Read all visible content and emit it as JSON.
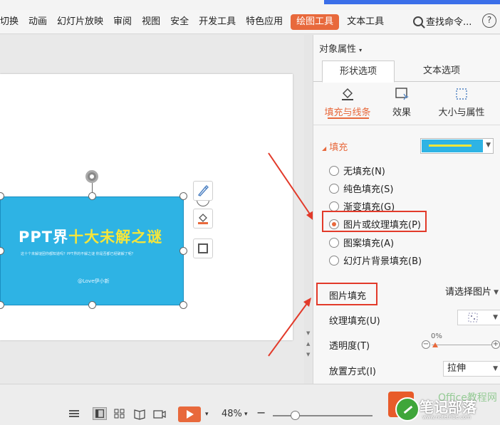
{
  "menu": {
    "items": [
      "切换",
      "动画",
      "幻灯片放映",
      "审阅",
      "视图",
      "安全",
      "开发工具",
      "特色应用",
      "绘图工具",
      "文本工具"
    ],
    "active_index": 8,
    "search_label": "查找命令...",
    "help_label": "?"
  },
  "slide": {
    "title_main": "PPT界",
    "title_highlight": "十大未解之谜",
    "subtitle": "这十个未解谜团你都知道吗？PPT界的不解之谜 你是否都已经破解了呢？",
    "author": "@Love伊小新"
  },
  "panel": {
    "title": "对象属性",
    "tabs": [
      "形状选项",
      "文本选项"
    ],
    "subtabs": [
      "填充与线条",
      "效果",
      "大小与属性"
    ],
    "fill_section": "填充",
    "fill_options": [
      "无填充(N)",
      "纯色填充(S)",
      "渐变填充(G)",
      "图片或纹理填充(P)",
      "图案填充(A)",
      "幻灯片背景填充(B)"
    ],
    "fill_selected_index": 3,
    "picture_fill_label": "图片填充",
    "picture_fill_value": "请选择图片",
    "texture_label": "纹理填充(U)",
    "transparency_label": "透明度(T)",
    "transparency_value": "0%",
    "placement_label": "放置方式(I)",
    "placement_value": "拉伸"
  },
  "statusbar": {
    "zoom": "48%"
  },
  "watermark": {
    "text": "笔记部落",
    "url": "www.notetribe.com",
    "ghost": "Office教程网"
  },
  "colors": {
    "accent": "#e8693c",
    "highlight_box": "#e23a2a",
    "shape_fill": "#2eb3e4",
    "title_highlight": "#f6e63a"
  }
}
